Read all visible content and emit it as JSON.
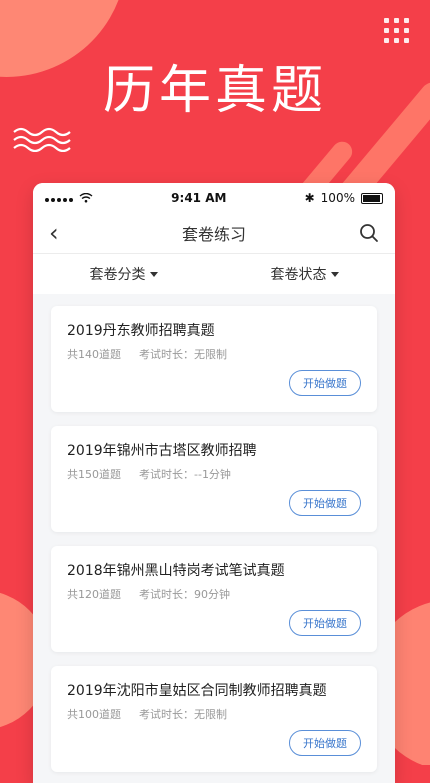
{
  "hero": {
    "title": "历年真题"
  },
  "status": {
    "time": "9:41 AM",
    "battery": "100%"
  },
  "nav": {
    "title": "套卷练习"
  },
  "filters": [
    {
      "label": "套卷分类"
    },
    {
      "label": "套卷状态"
    }
  ],
  "papers": [
    {
      "title": "2019丹东教师招聘真题",
      "count": "共140道题",
      "duration": "考试时长：无限制",
      "action": "开始做题"
    },
    {
      "title": "2019年锦州市古塔区教师招聘",
      "count": "共150道题",
      "duration": "考试时长：--1分钟",
      "action": "开始做题"
    },
    {
      "title": "2018年锦州黑山特岗考试笔试真题",
      "count": "共120道题",
      "duration": "考试时长：90分钟",
      "action": "开始做题"
    },
    {
      "title": "2019年沈阳市皇姑区合同制教师招聘真题",
      "count": "共100道题",
      "duration": "考试时长：无限制",
      "action": "开始做题"
    }
  ],
  "colors": {
    "brand": "#f43f49",
    "accent": "#ff8f79",
    "button": "#3a77cc"
  }
}
